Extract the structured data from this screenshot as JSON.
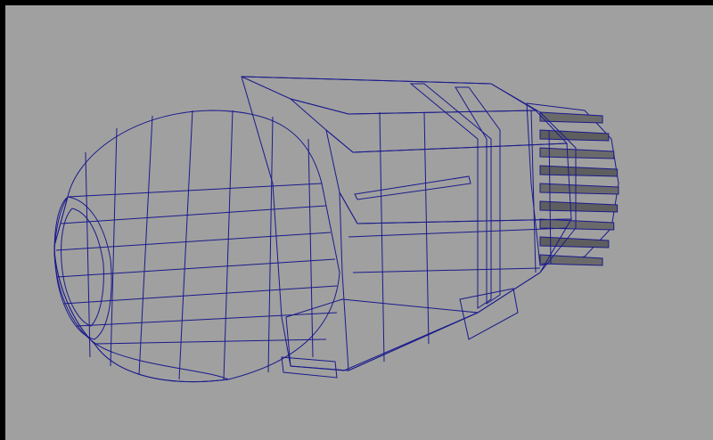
{
  "viewport": {
    "background_color": "#a0a0a0",
    "frame_color": "#000000",
    "wireframe_color": "#1a1a8c",
    "model": {
      "kind": "polygon-mesh",
      "description_name": "thruster-engine-mesh",
      "display_mode": "wireframe-on-shaded",
      "shade_light": "#6a6a6a",
      "shade_mid": "#555555",
      "shade_dark": "#3a3a3a",
      "shade_darkest": "#1e1e1e"
    }
  }
}
